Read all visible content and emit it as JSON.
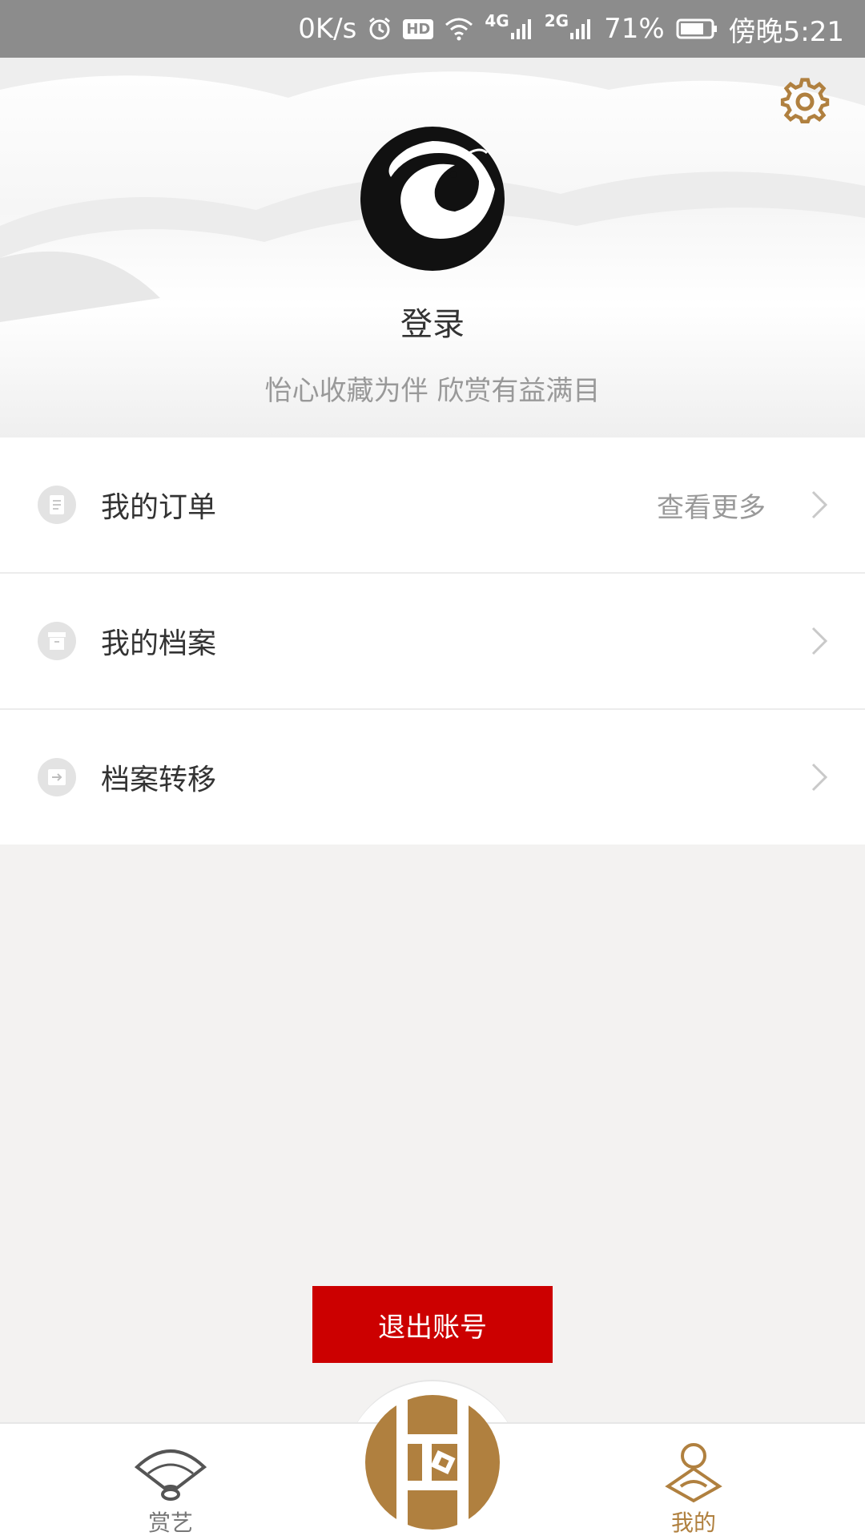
{
  "status_bar": {
    "speed": "0K/s",
    "hd": "HD",
    "net1": "4G",
    "net2": "2G",
    "battery": "71%",
    "time": "傍晚5:21"
  },
  "profile": {
    "login_label": "登录",
    "slogan": "怡心收藏为伴 欣赏有益满目"
  },
  "menu": {
    "items": [
      {
        "label": "我的订单",
        "extra": "查看更多",
        "icon": "order-list-icon"
      },
      {
        "label": "我的档案",
        "extra": "",
        "icon": "archive-box-icon"
      },
      {
        "label": "档案转移",
        "extra": "",
        "icon": "transfer-icon"
      }
    ]
  },
  "logout_label": "退出账号",
  "tabs": [
    {
      "label": "赏艺",
      "icon": "fan-icon"
    },
    {
      "label": "",
      "icon": "center-logo-icon"
    },
    {
      "label": "我的",
      "icon": "user-icon"
    }
  ],
  "colors": {
    "accent": "#b0803f",
    "logout": "#cc0000",
    "background": "#f3f2f1"
  }
}
